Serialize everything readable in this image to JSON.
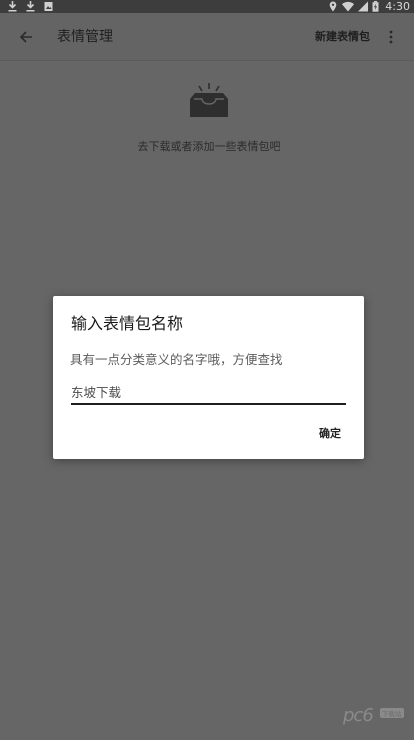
{
  "status_bar": {
    "time": "4:30",
    "left_icons": [
      "download-icon",
      "download-icon",
      "image-notification-icon"
    ],
    "right_icons": [
      "location-icon",
      "wifi-icon",
      "signal-icon",
      "battery-icon"
    ]
  },
  "app_bar": {
    "title": "表情管理",
    "action_label": "新建表情包"
  },
  "empty_state": {
    "icon": "inbox-icon",
    "message": "去下载或者添加一些表情包吧"
  },
  "dialog": {
    "title": "输入表情包名称",
    "message": "具有一点分类意义的名字哦，方便查找",
    "input_value": "东坡下载",
    "confirm_label": "确定"
  },
  "watermark": {
    "text": "pc6",
    "sub": "下载站"
  }
}
